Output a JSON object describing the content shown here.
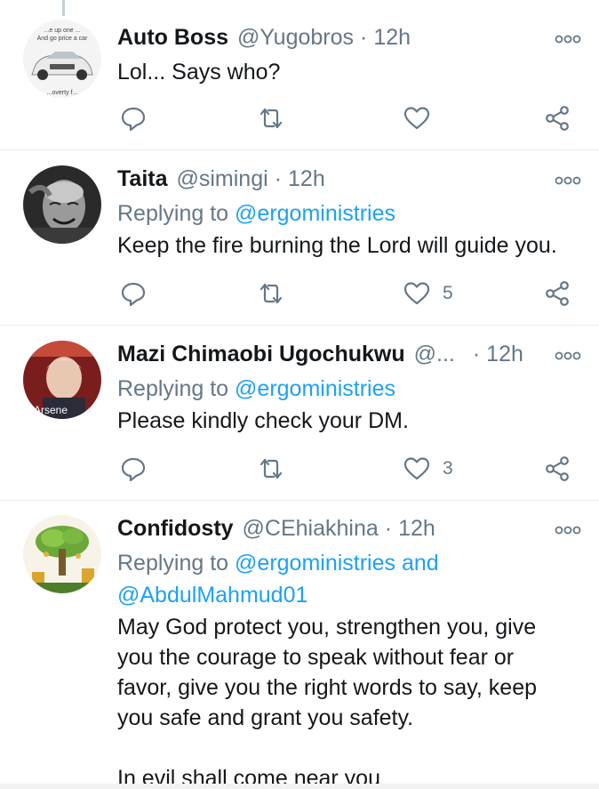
{
  "tweets": [
    {
      "name": "Auto Boss",
      "handle": "@Yugobros",
      "time": "12h",
      "reply_prefix": "",
      "reply_mentions": "",
      "reply_second_line": "",
      "text": "Lol... Says who?",
      "like_count": "",
      "avatar": "car-advert",
      "avatar_text_top": "...e up one ...",
      "avatar_text_mid": "And go price a car",
      "avatar_text_bottom": "...overty f..."
    },
    {
      "name": "Taita",
      "handle": "@simingi",
      "time": "12h",
      "reply_prefix": "Replying to",
      "reply_mentions": "@ergoministries",
      "reply_second_line": "",
      "text": "Keep the fire burning the Lord will guide you.",
      "like_count": "5",
      "avatar": "old-man-bw"
    },
    {
      "name": "Mazi Chimaobi Ugochukwu",
      "handle": "@...",
      "time": "12h",
      "reply_prefix": "Replying to",
      "reply_mentions": "@ergoministries",
      "reply_second_line": "",
      "text": "Please kindly check your DM.",
      "like_count": "3",
      "avatar": "book-cover-portrait",
      "avatar_text": "Arsene"
    },
    {
      "name": "Confidosty",
      "handle": "@CEhiakhina",
      "time": "12h",
      "reply_prefix": "Replying to",
      "reply_mentions": "@ergoministries and",
      "reply_second_line": "@AbdulMahmud01",
      "text_lines": [
        "May God protect you, strengthen you, give",
        "you the courage to speak without fear or",
        "favor, give you the right words to say, keep",
        "you safe and grant you safety.",
        "",
        "In  evil shall come near you"
      ],
      "avatar": "money-tree"
    }
  ],
  "colors": {
    "accent": "#1da1f2",
    "secondary_text": "#657786",
    "primary_text": "#14171a",
    "divider": "#e6ecf0",
    "icon": "#657786"
  },
  "icons": {
    "reply": "reply-icon",
    "retweet": "retweet-icon",
    "like": "heart-icon",
    "share": "share-icon",
    "more": "more-options-icon"
  }
}
